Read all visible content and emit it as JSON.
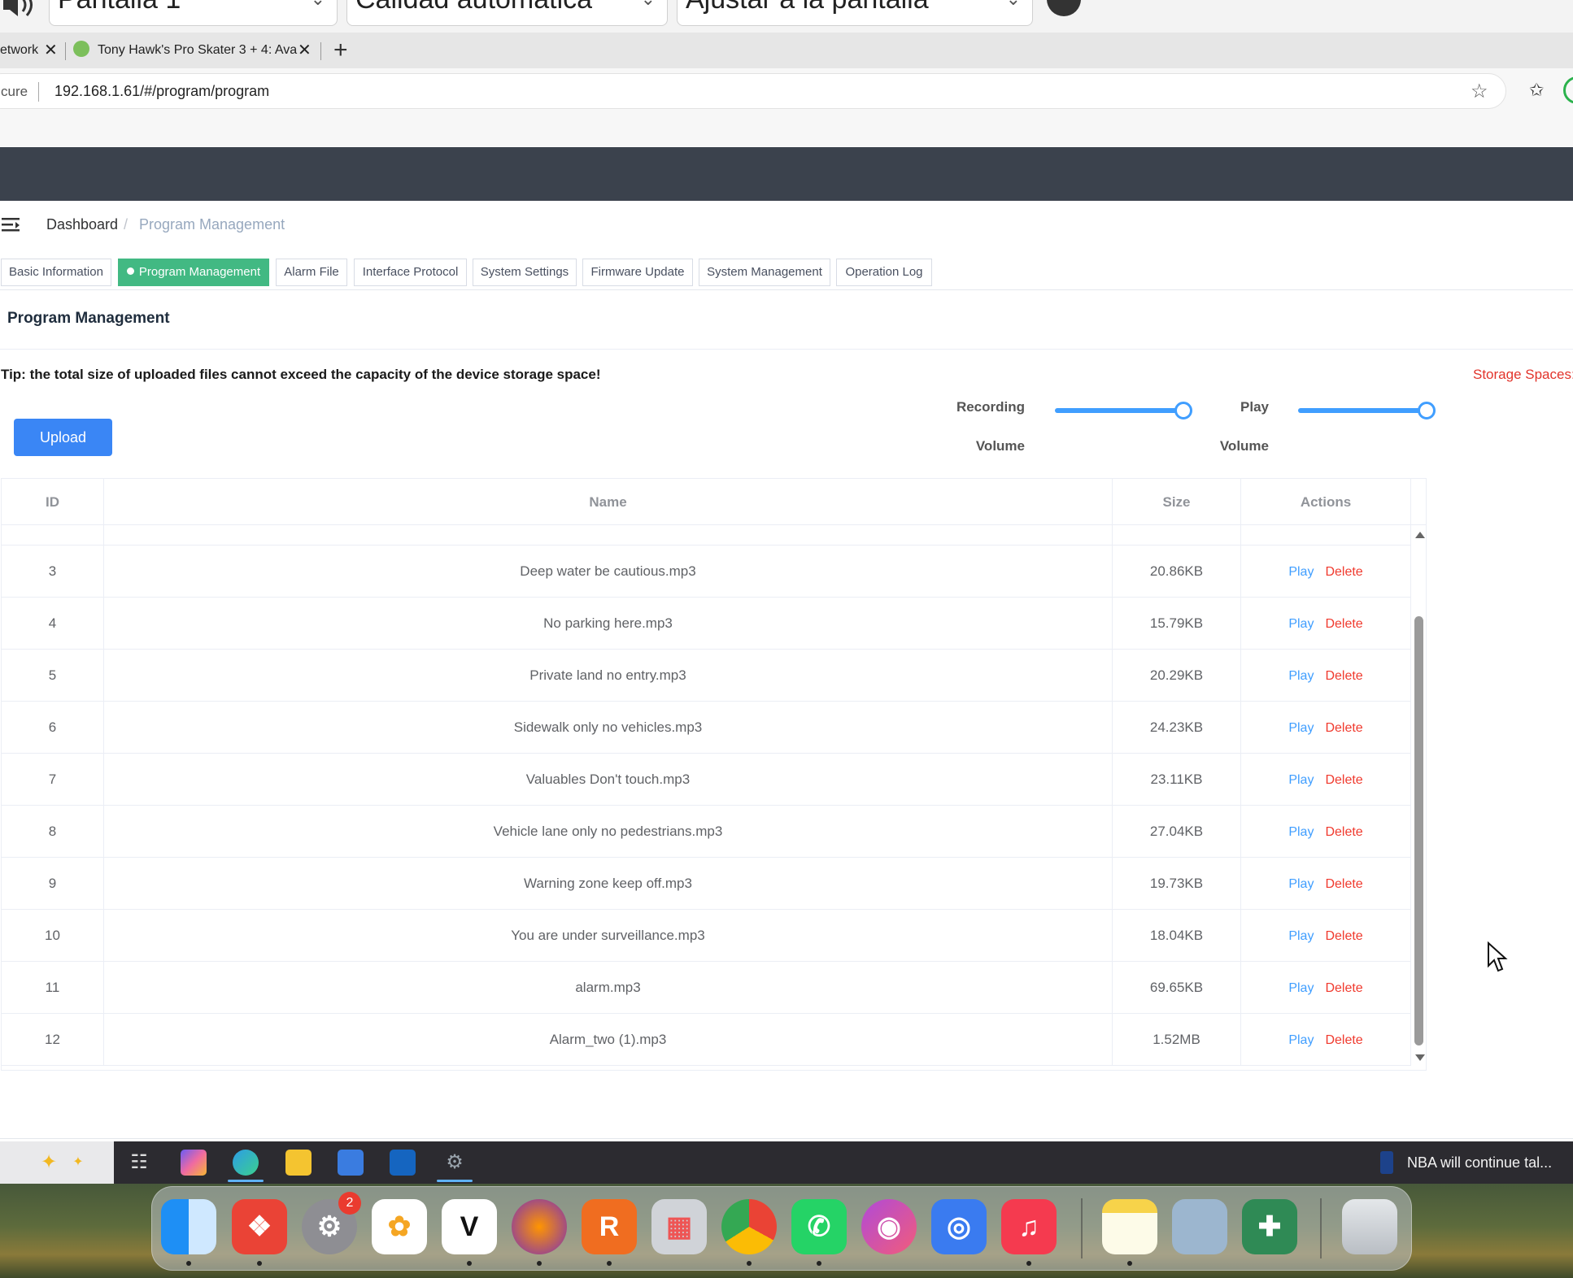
{
  "viewer_toolbar": {
    "screen_select": "Pantalla 1",
    "quality_select": "Calidad automática",
    "fit_select": "Ajustar a la pantalla"
  },
  "browser": {
    "tabs": [
      {
        "title": "etwork"
      },
      {
        "title": "Tony Hawk's Pro Skater 3 + 4: Ava"
      }
    ],
    "address": {
      "security": "cure",
      "url": "192.168.1.61/#/program/program"
    }
  },
  "breadcrumb": {
    "home": "Dashboard",
    "separator": "/",
    "current": "Program Management"
  },
  "tags": [
    {
      "label": "Basic Information",
      "active": false
    },
    {
      "label": "Program Management",
      "active": true
    },
    {
      "label": "Alarm File",
      "active": false
    },
    {
      "label": "Interface Protocol",
      "active": false
    },
    {
      "label": "System Settings",
      "active": false
    },
    {
      "label": "Firmware Update",
      "active": false
    },
    {
      "label": "System Management",
      "active": false
    },
    {
      "label": "Operation Log",
      "active": false
    }
  ],
  "page": {
    "title": "Program Management",
    "tip": "Tip: the total size of uploaded files cannot exceed the capacity of the device storage space!",
    "storage_label": "Storage Spaces:",
    "upload_label": "Upload"
  },
  "volume": {
    "recording": {
      "label_top": "Recording",
      "label_bottom": "Volume",
      "level": 1.0
    },
    "play": {
      "label_top": "Play",
      "label_bottom": "Volume",
      "level": 1.0
    }
  },
  "table": {
    "columns": [
      "ID",
      "Name",
      "Size",
      "Actions"
    ],
    "action_play": "Play",
    "action_delete": "Delete",
    "rows": [
      {
        "id": "3",
        "name": "Deep water be cautious.mp3",
        "size": "20.86KB"
      },
      {
        "id": "4",
        "name": "No parking here.mp3",
        "size": "15.79KB"
      },
      {
        "id": "5",
        "name": "Private land no entry.mp3",
        "size": "20.29KB"
      },
      {
        "id": "6",
        "name": "Sidewalk only no vehicles.mp3",
        "size": "24.23KB"
      },
      {
        "id": "7",
        "name": "Valuables Don't touch.mp3",
        "size": "23.11KB"
      },
      {
        "id": "8",
        "name": "Vehicle lane only no pedestrians.mp3",
        "size": "27.04KB"
      },
      {
        "id": "9",
        "name": "Warning zone keep off.mp3",
        "size": "19.73KB"
      },
      {
        "id": "10",
        "name": "You are under surveillance.mp3",
        "size": "18.04KB"
      },
      {
        "id": "11",
        "name": "alarm.mp3",
        "size": "69.65KB"
      },
      {
        "id": "12",
        "name": "Alarm_two (1).mp3",
        "size": "1.52MB"
      }
    ]
  },
  "taskbar": {
    "news_text": "NBA will continue tal..."
  },
  "dock": {
    "settings_badge": "2"
  },
  "colors": {
    "header_bg": "#3b424d",
    "tag_active": "#42b983",
    "primary": "#3a86f5",
    "danger": "#f03a2e",
    "slider": "#409eff"
  }
}
